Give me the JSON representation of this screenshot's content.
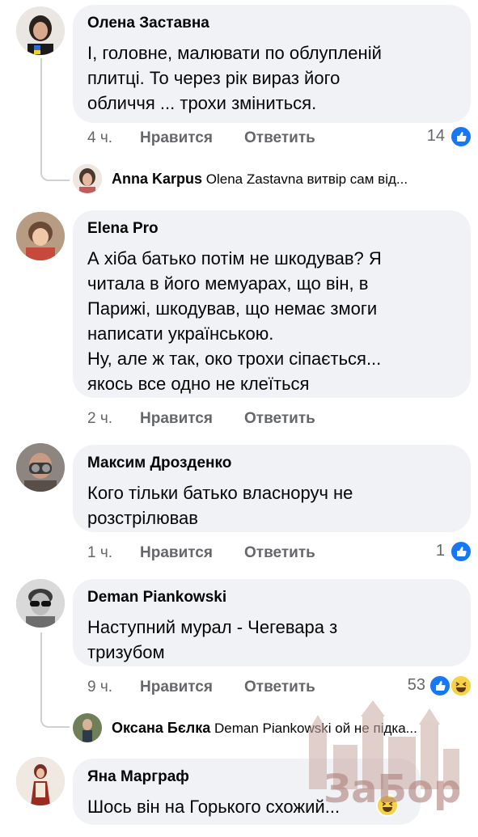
{
  "comments": [
    {
      "author": "Олена Заставна",
      "lines": [
        "І, головне, малювати по облупленій",
        "плитці. То через рік вираз його",
        "обличчя ... трохи зміниться."
      ],
      "time": "4 ч.",
      "like_label": "Нравится",
      "reply_label": "Ответить",
      "reactions": "14"
    },
    {
      "author": "Elena Pro",
      "lines": [
        "А хіба батько потім не шкодував? Я",
        "читала в його мемуарах, що він, в",
        "Парижі, шкодував, що немає змоги",
        "написати українською.",
        "Ну, але ж так, око трохи сіпається...",
        "якось все одно не клеїться"
      ],
      "time": "2 ч.",
      "like_label": "Нравится",
      "reply_label": "Ответить"
    },
    {
      "author": "Максим Дрозденко",
      "lines": [
        "Кого тільки батько власноруч не",
        "розстрілював"
      ],
      "time": "1 ч.",
      "like_label": "Нравится",
      "reply_label": "Ответить",
      "reactions": "1"
    },
    {
      "author": "Deman Piankowski",
      "lines": [
        "Наступний мурал - Чегевара з",
        "тризубом"
      ],
      "time": "9 ч.",
      "like_label": "Нравится",
      "reply_label": "Ответить",
      "reactions": "53"
    },
    {
      "author": "Яна Марграф",
      "lines": [
        "Шось він на Горького схожий..."
      ]
    }
  ],
  "replies": [
    {
      "author": "Anna Karpus",
      "text": "Olena Zastavna  витвір сам від..."
    },
    {
      "author": "Оксана Бєлка",
      "text": "Deman Piankowski ой не підка..."
    }
  ],
  "watermark": "ЗаБор",
  "icons": {
    "like": "like-icon",
    "haha": "haha-emoji-icon"
  },
  "colors": {
    "like_blue": "#1877f2",
    "bubble_bg": "#f0f2f5",
    "meta_gray": "#65676b"
  }
}
